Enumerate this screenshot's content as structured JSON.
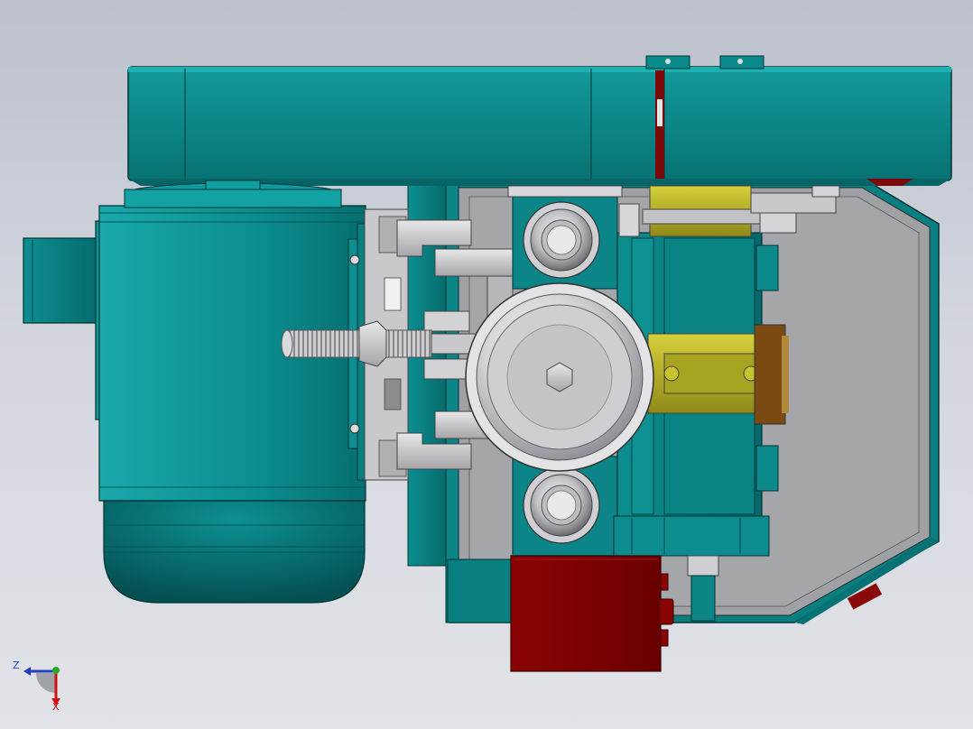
{
  "view": {
    "background_top": "#bcc1cc",
    "background_bottom": "#e1e3e8",
    "model_colors": {
      "teal": "#0a8a8c",
      "teal_dark": "#066a6c",
      "teal_light": "#19a5a6",
      "gray_housing": "#9c9ea2",
      "steel": "#c8c8cc",
      "yellow_bracket": "#b6b027",
      "red_box": "#7d0000",
      "brown_block": "#7a4a12"
    }
  },
  "triad": {
    "z_label": "Z",
    "x_label": "X",
    "z_color": "#1f3fbf",
    "x_color": "#d01010",
    "y_color": "#22aa22"
  }
}
